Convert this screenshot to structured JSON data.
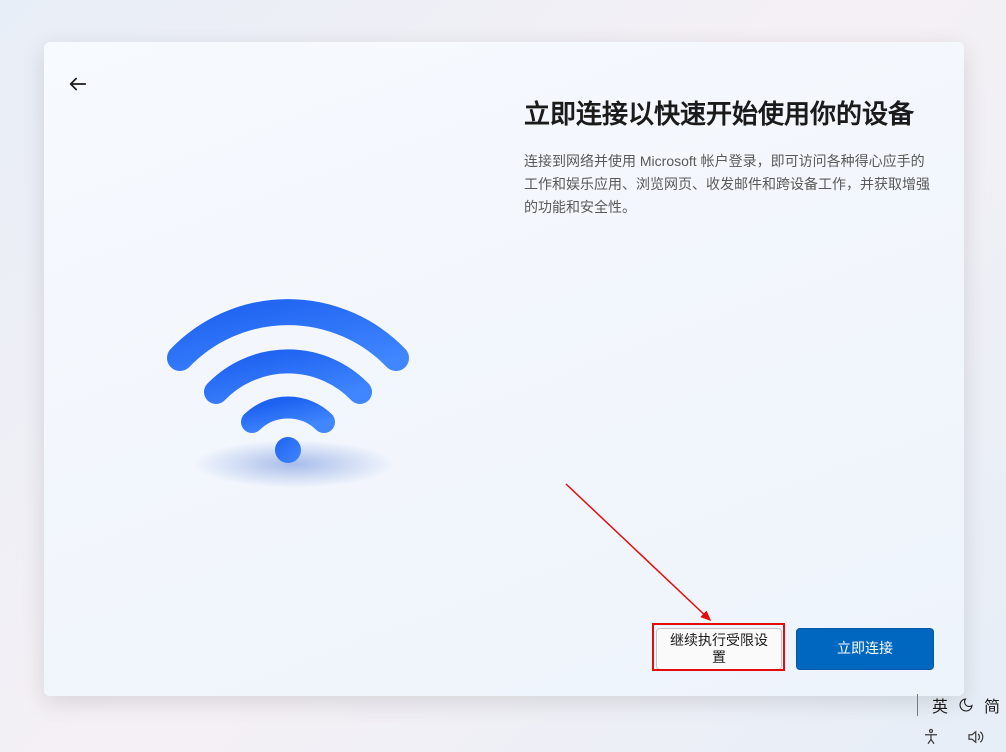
{
  "page": {
    "title": "立即连接以快速开始使用你的设备",
    "description": "连接到网络并使用 Microsoft 帐户登录，即可访问各种得心应手的工作和娱乐应用、浏览网页、收发邮件和跨设备工作，并获取增强的功能和安全性。"
  },
  "buttons": {
    "secondary_label": "继续执行受限设置",
    "primary_label": "立即连接"
  },
  "ime": {
    "lang": "英",
    "mode": "简"
  },
  "colors": {
    "primary_button": "#0067c0",
    "annotation_red": "#e40b0b",
    "wifi_gradient_start": "#1e62f0",
    "wifi_gradient_end": "#3f86ff"
  }
}
